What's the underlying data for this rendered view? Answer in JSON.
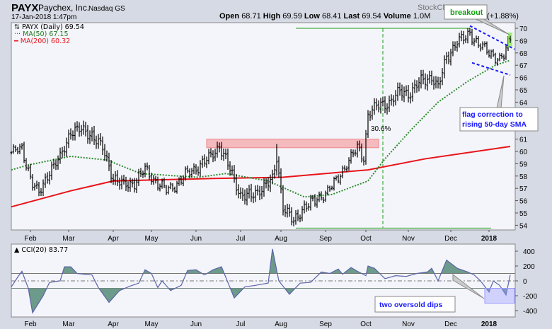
{
  "header": {
    "symbol": "PAYX",
    "company": "Paychex, Inc.",
    "exchange": "Nasdaq GS",
    "datetime": "17-Jan-2018 1:47pm",
    "open_label": "Open",
    "open": "68.71",
    "high_label": "High",
    "high": "69.59",
    "low_label": "Low",
    "low": "68.41",
    "last_label": "Last",
    "last": "69.54",
    "volume_label": "Volume",
    "volume": "1.0M",
    "change_pct": "(+1.88%)",
    "watermark": "StockCharts.com"
  },
  "legend": {
    "price": "PAYX (Daily) 69.54",
    "ma50": "MA(50) 67.15",
    "ma200": "MA(200) 60.32",
    "cci": "CCI(20) 83.77"
  },
  "annotations": {
    "breakout": "breakout",
    "flag_line1": "flag correction to",
    "flag_line2": "rising 50-day SMA",
    "pct_gain": "30.6%",
    "oversold": "two oversold dips"
  },
  "colors": {
    "ma50": "#2e8b2e",
    "ma200": "#e8141b",
    "resistance_zone": "#f4a6aa",
    "trendline": "#1a1aff",
    "cci_fill": "#6c9a8b",
    "cci_line": "#5b63a8"
  },
  "chart_data": [
    {
      "type": "line",
      "title": "PAYX (Daily)",
      "x_unit": "trading day index",
      "month_ticks": [
        {
          "label": "Feb",
          "t": 9
        },
        {
          "label": "Mar",
          "t": 27
        },
        {
          "label": "Apr",
          "t": 48
        },
        {
          "label": "May",
          "t": 66
        },
        {
          "label": "Jun",
          "t": 87
        },
        {
          "label": "Jul",
          "t": 108
        },
        {
          "label": "Aug",
          "t": 127
        },
        {
          "label": "Sep",
          "t": 148
        },
        {
          "label": "Oct",
          "t": 167
        },
        {
          "label": "Nov",
          "t": 187
        },
        {
          "label": "Dec",
          "t": 207
        },
        {
          "label": "2018",
          "t": 225
        }
      ],
      "y_ticks": [
        54,
        55,
        56,
        57,
        58,
        59,
        60,
        61,
        62,
        63,
        64,
        65,
        66,
        67,
        68,
        69,
        70
      ],
      "ylim": [
        53.6,
        70.5
      ],
      "xlim": [
        0,
        237
      ],
      "close": [
        [
          0,
          59.9
        ],
        [
          5,
          60.2
        ],
        [
          10,
          57.4
        ],
        [
          13,
          56.5
        ],
        [
          18,
          58.5
        ],
        [
          23,
          59.4
        ],
        [
          28,
          61.7
        ],
        [
          33,
          61.7
        ],
        [
          38,
          61.4
        ],
        [
          43,
          60.2
        ],
        [
          48,
          57.9
        ],
        [
          53,
          57.2
        ],
        [
          58,
          57.5
        ],
        [
          63,
          58.5
        ],
        [
          68,
          57.6
        ],
        [
          73,
          56.8
        ],
        [
          78,
          57.4
        ],
        [
          83,
          58.2
        ],
        [
          88,
          58.8
        ],
        [
          93,
          59.4
        ],
        [
          98,
          60.5
        ],
        [
          103,
          58.5
        ],
        [
          108,
          56.5
        ],
        [
          113,
          56.3
        ],
        [
          118,
          57.1
        ],
        [
          123,
          57.6
        ],
        [
          125,
          59.5
        ],
        [
          128,
          55.6
        ],
        [
          133,
          54.2
        ],
        [
          138,
          55.6
        ],
        [
          143,
          55.9
        ],
        [
          148,
          56.7
        ],
        [
          153,
          57.5
        ],
        [
          158,
          59.1
        ],
        [
          163,
          60.2
        ],
        [
          166,
          59.5
        ],
        [
          168,
          63.1
        ],
        [
          173,
          63.7
        ],
        [
          178,
          64.0
        ],
        [
          183,
          64.8
        ],
        [
          188,
          64.8
        ],
        [
          193,
          65.7
        ],
        [
          198,
          66.1
        ],
        [
          201,
          65.1
        ],
        [
          205,
          67.7
        ],
        [
          210,
          68.9
        ],
        [
          213,
          69.1
        ],
        [
          216,
          69.7
        ],
        [
          220,
          68.6
        ],
        [
          223,
          68.3
        ],
        [
          226,
          68.0
        ],
        [
          230,
          67.4
        ],
        [
          232,
          67.7
        ],
        [
          235,
          69.3
        ]
      ],
      "ma50": [
        [
          0,
          58.5
        ],
        [
          8,
          58.9
        ],
        [
          28,
          59.6
        ],
        [
          45,
          59.3
        ],
        [
          61,
          58.2
        ],
        [
          88,
          57.9
        ],
        [
          101,
          58.2
        ],
        [
          121,
          57.6
        ],
        [
          138,
          56.3
        ],
        [
          151,
          56.5
        ],
        [
          168,
          57.6
        ],
        [
          176,
          59.4
        ],
        [
          188,
          61.7
        ],
        [
          201,
          64.0
        ],
        [
          215,
          65.7
        ],
        [
          228,
          67.0
        ],
        [
          235,
          67.4
        ]
      ],
      "ma200": [
        [
          0,
          55.5
        ],
        [
          28,
          56.8
        ],
        [
          48,
          57.6
        ],
        [
          95,
          57.8
        ],
        [
          128,
          57.9
        ],
        [
          168,
          58.5
        ],
        [
          195,
          59.4
        ],
        [
          235,
          60.4
        ]
      ],
      "resistance_zone": {
        "t": [
          92,
          173
        ],
        "price": [
          60.3,
          61.0
        ]
      },
      "breakout_levels": {
        "high": 70,
        "low": 54,
        "t_start": 134,
        "t_high_end": 216,
        "t_low_end": 226,
        "vline_t": 175
      },
      "flag_upper": [
        [
          216,
          70.2
        ],
        [
          237,
          68.3
        ]
      ],
      "flag_lower": [
        [
          217,
          67.2
        ],
        [
          235,
          66.2
        ]
      ]
    },
    {
      "type": "area",
      "title": "CCI(20)",
      "y_ticks": [
        -400,
        -200,
        0,
        200,
        400
      ],
      "ylim": [
        -490,
        490
      ],
      "bands": [
        -100,
        100
      ],
      "values": [
        [
          0,
          -80
        ],
        [
          3,
          50
        ],
        [
          5,
          130
        ],
        [
          8,
          -100
        ],
        [
          10,
          -430
        ],
        [
          15,
          -200
        ],
        [
          18,
          -20
        ],
        [
          23,
          0
        ],
        [
          25,
          190
        ],
        [
          28,
          190
        ],
        [
          31,
          100
        ],
        [
          38,
          80
        ],
        [
          41,
          -90
        ],
        [
          46,
          -290
        ],
        [
          51,
          -130
        ],
        [
          56,
          -70
        ],
        [
          60,
          -30
        ],
        [
          63,
          150
        ],
        [
          66,
          100
        ],
        [
          69,
          -90
        ],
        [
          71,
          0
        ],
        [
          75,
          -130
        ],
        [
          80,
          -60
        ],
        [
          83,
          140
        ],
        [
          87,
          150
        ],
        [
          91,
          80
        ],
        [
          95,
          150
        ],
        [
          99,
          190
        ],
        [
          105,
          -230
        ],
        [
          110,
          -80
        ],
        [
          115,
          -60
        ],
        [
          121,
          -30
        ],
        [
          123,
          430
        ],
        [
          126,
          0
        ],
        [
          131,
          -180
        ],
        [
          136,
          -30
        ],
        [
          141,
          -20
        ],
        [
          146,
          120
        ],
        [
          150,
          100
        ],
        [
          154,
          160
        ],
        [
          156,
          90
        ],
        [
          160,
          180
        ],
        [
          163,
          130
        ],
        [
          167,
          70
        ],
        [
          168,
          200
        ],
        [
          171,
          170
        ],
        [
          176,
          30
        ],
        [
          181,
          70
        ],
        [
          186,
          60
        ],
        [
          191,
          100
        ],
        [
          196,
          120
        ],
        [
          198,
          170
        ],
        [
          201,
          0
        ],
        [
          205,
          280
        ],
        [
          210,
          170
        ],
        [
          215,
          120
        ],
        [
          218,
          80
        ],
        [
          221,
          0
        ],
        [
          225,
          -150
        ],
        [
          227,
          0
        ],
        [
          230,
          -60
        ],
        [
          233,
          -190
        ],
        [
          235,
          80
        ]
      ],
      "oversold_box": {
        "t": [
          223,
          237
        ],
        "value": [
          -100,
          -300
        ]
      }
    }
  ]
}
